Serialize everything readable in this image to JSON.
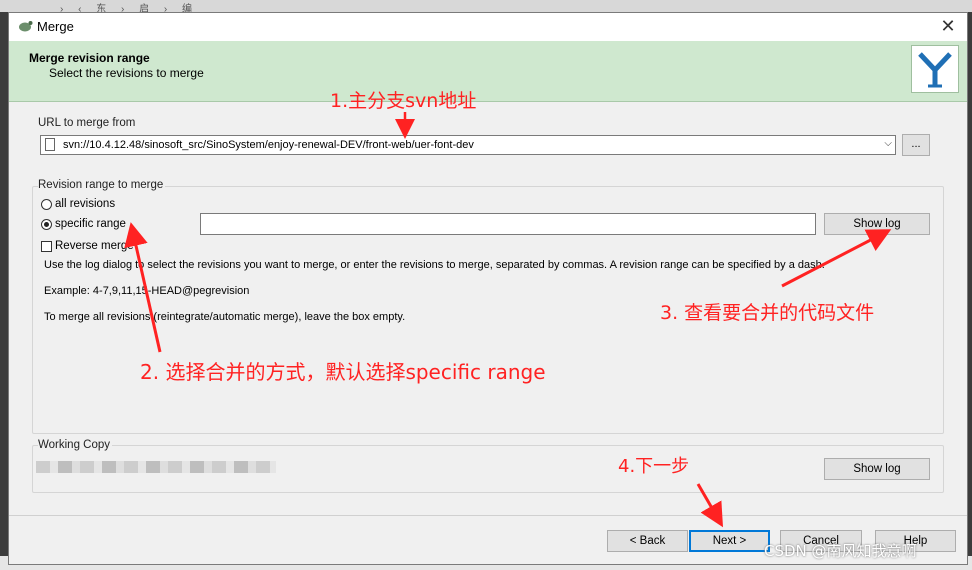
{
  "window": {
    "title": "Merge"
  },
  "header": {
    "title": "Merge revision range",
    "subtitle": "Select the revisions to merge"
  },
  "url_group": {
    "label": "URL to merge from",
    "url": "svn://10.4.12.48/sinosoft_src/SinoSystem/enjoy-renewal-DEV/front-web/uer-font-dev",
    "browse_label": "..."
  },
  "range_group": {
    "label": "Revision range to merge",
    "all_revisions": "all revisions",
    "specific_range": "specific range",
    "specific_value": "",
    "show_log": "Show log",
    "reverse_merge": "Reverse merge",
    "help_text_1": "Use the log dialog to select the revisions you want to merge, or enter the revisions to merge, separated by commas. A revision range can be specified by a dash.",
    "example": "Example: 4-7,9,11,15-HEAD@pegrevision",
    "help_text_2": "To merge all revisions (reintegrate/automatic merge), leave the box empty."
  },
  "wc_group": {
    "label": "Working Copy",
    "show_log": "Show log"
  },
  "footer": {
    "back": "< Back",
    "next": "Next >",
    "cancel": "Cancel",
    "help": "Help"
  },
  "annotations": {
    "a1": "1.主分支svn地址",
    "a2": "2. 选择合并的方式，默认选择specific range",
    "a3": "3. 查看要合并的代码文件",
    "a4": "4.下一步",
    "color": "#ff2222"
  },
  "watermark": "CSDN @南风知我意啊"
}
